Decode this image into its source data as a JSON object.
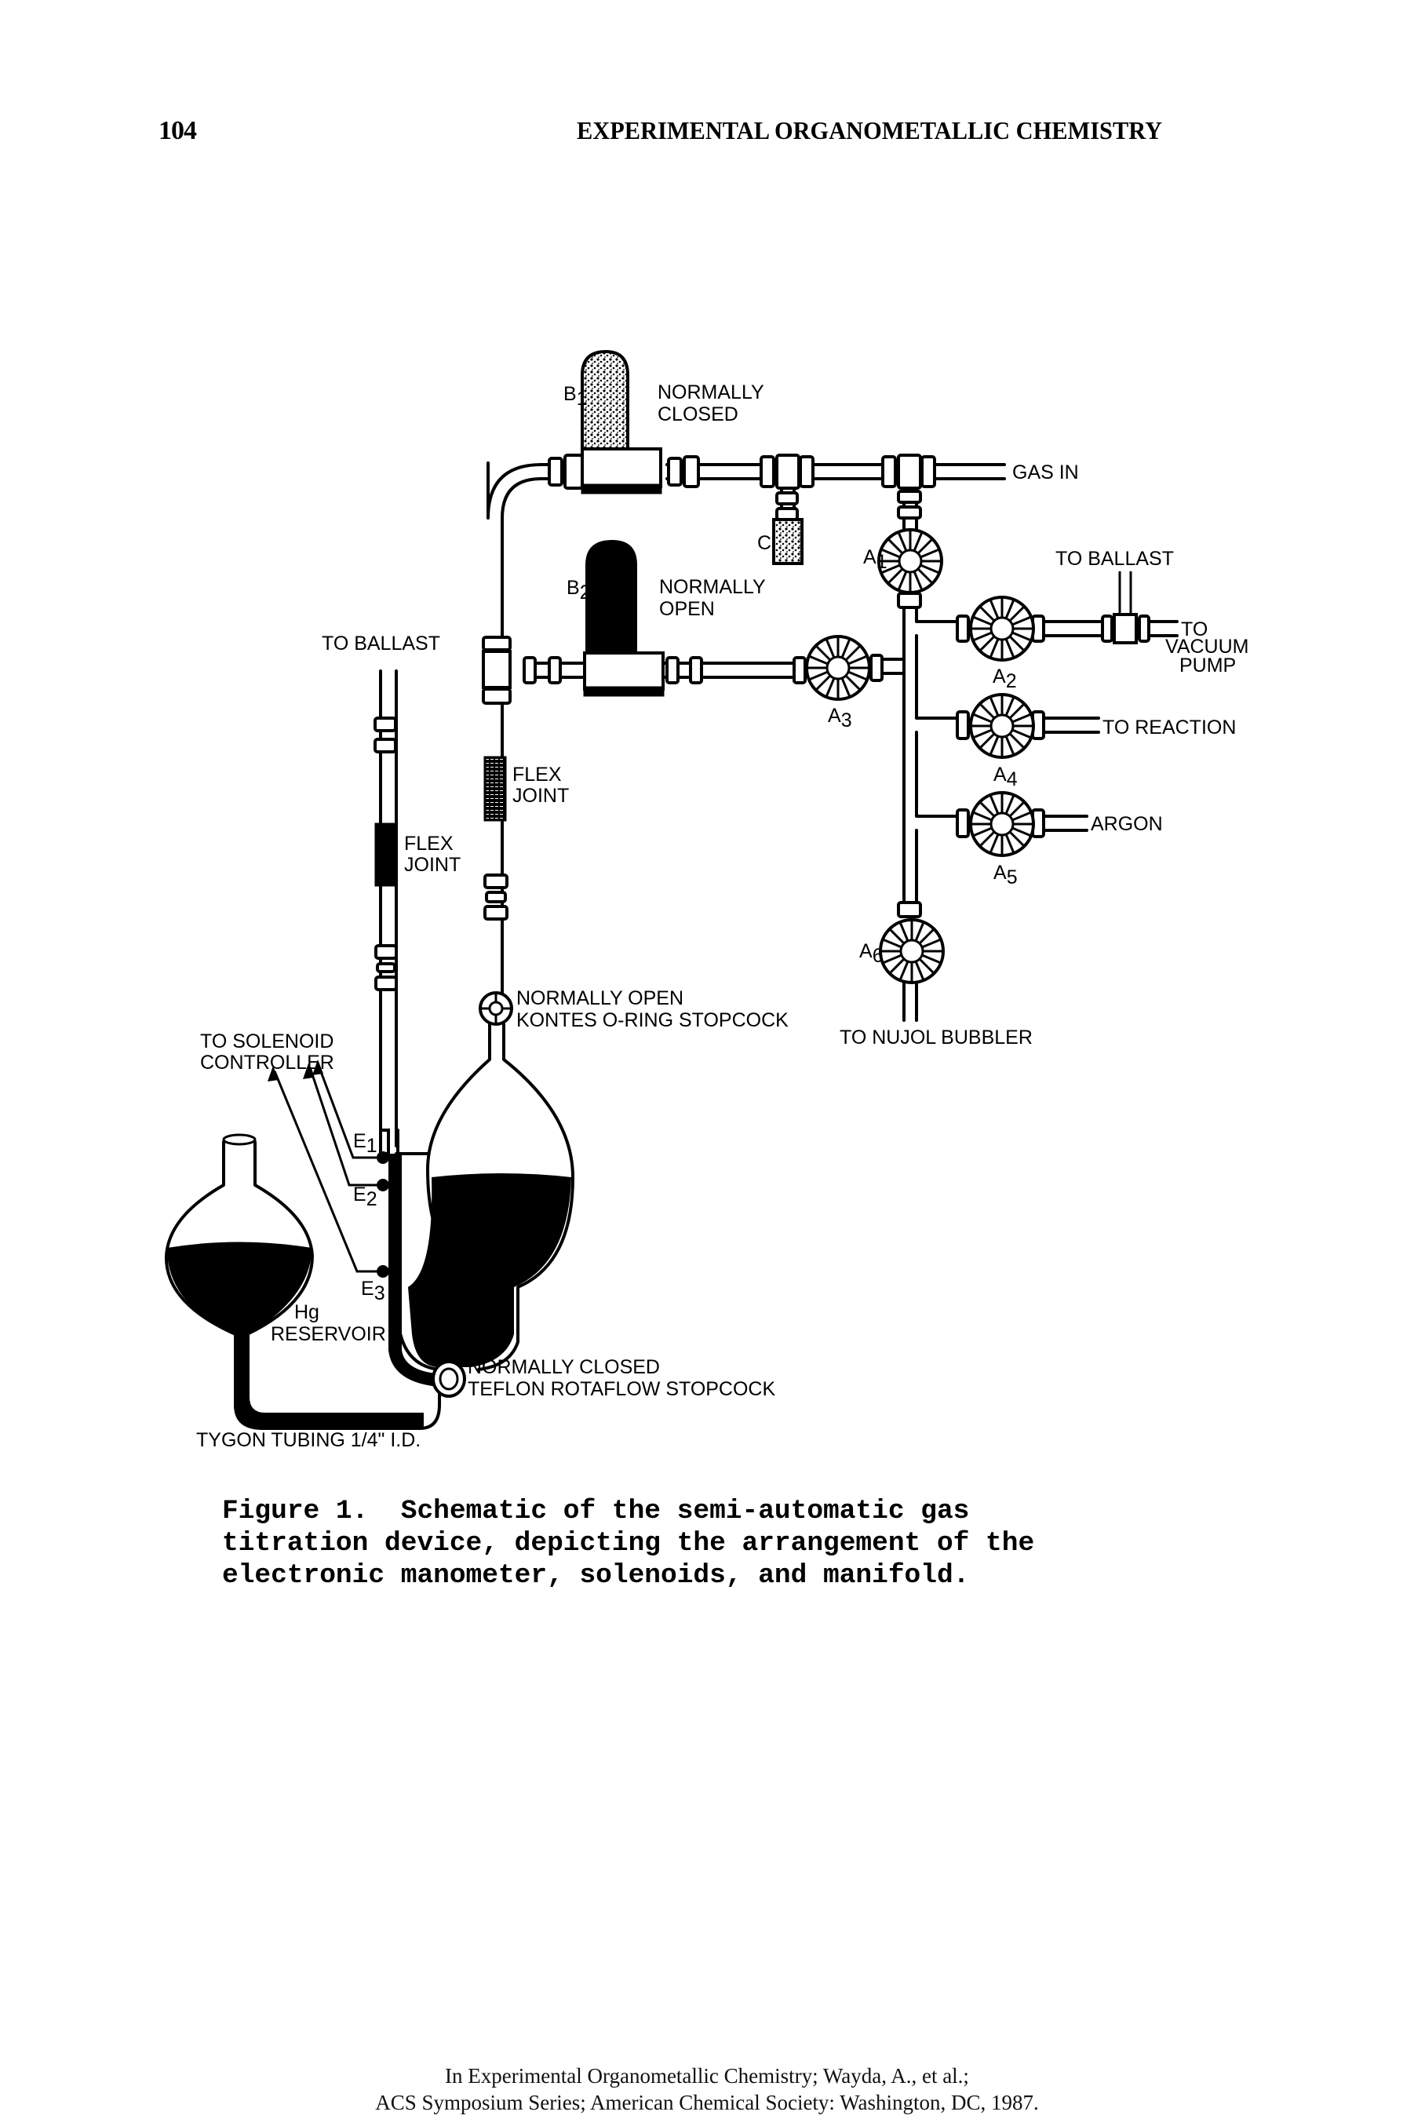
{
  "header": {
    "page_number": "104",
    "running_title": "EXPERIMENTAL ORGANOMETALLIC CHEMISTRY"
  },
  "figure": {
    "labels": {
      "b1": "B",
      "b1_sub": "1",
      "b1_state_line1": "NORMALLY",
      "b1_state_line2": "CLOSED",
      "b2": "B",
      "b2_sub": "2",
      "b2_state_line1": "NORMALLY",
      "b2_state_line2": "OPEN",
      "c": "C",
      "gas_in": "GAS IN",
      "a1": "A",
      "a1_sub": "1",
      "a2": "A",
      "a2_sub": "2",
      "a3": "A",
      "a3_sub": "3",
      "a4": "A",
      "a4_sub": "4",
      "a5": "A",
      "a5_sub": "5",
      "a6": "A",
      "a6_sub": "6",
      "to_ballast_right": "TO BALLAST",
      "to_vacuum_line1": "TO",
      "to_vacuum_line2": "VACUUM",
      "to_vacuum_line3": "PUMP",
      "to_reaction": "TO  REACTION",
      "argon": "ARGON",
      "to_nujol": "TO  NUJOL  BUBBLER",
      "to_ballast_left": "TO BALLAST",
      "flex_joint_left_line1": "FLEX",
      "flex_joint_left_line2": "JOINT",
      "flex_joint_mid_line1": "FLEX",
      "flex_joint_mid_line2": "JOINT",
      "kontes_line1": "NORMALLY  OPEN",
      "kontes_line2": "KONTES  O-RING  STOPCOCK",
      "solenoid_line1": "TO  SOLENOID",
      "solenoid_line2": "CONTROLLER",
      "e1": "E",
      "e1_sub": "1",
      "e2": "E",
      "e2_sub": "2",
      "e3": "E",
      "e3_sub": "3",
      "hg_line1": "Hg",
      "hg_line2": "RESERVOIR",
      "rotaflow_line1": "NORMALLY  CLOSED",
      "rotaflow_line2": "TEFLON  ROTAFLOW  STOPCOCK",
      "tygon": "TYGON  TUBING  1/4\"  I.D."
    }
  },
  "caption": {
    "text": "Figure 1.  Schematic of the semi-automatic gas\ntitration device, depicting the arrangement of the\nelectronic manometer, solenoids, and manifold."
  },
  "footer": {
    "line1": "In Experimental Organometallic Chemistry; Wayda, A., et al.;",
    "line2": "ACS Symposium Series; American Chemical Society: Washington, DC, 1987."
  }
}
